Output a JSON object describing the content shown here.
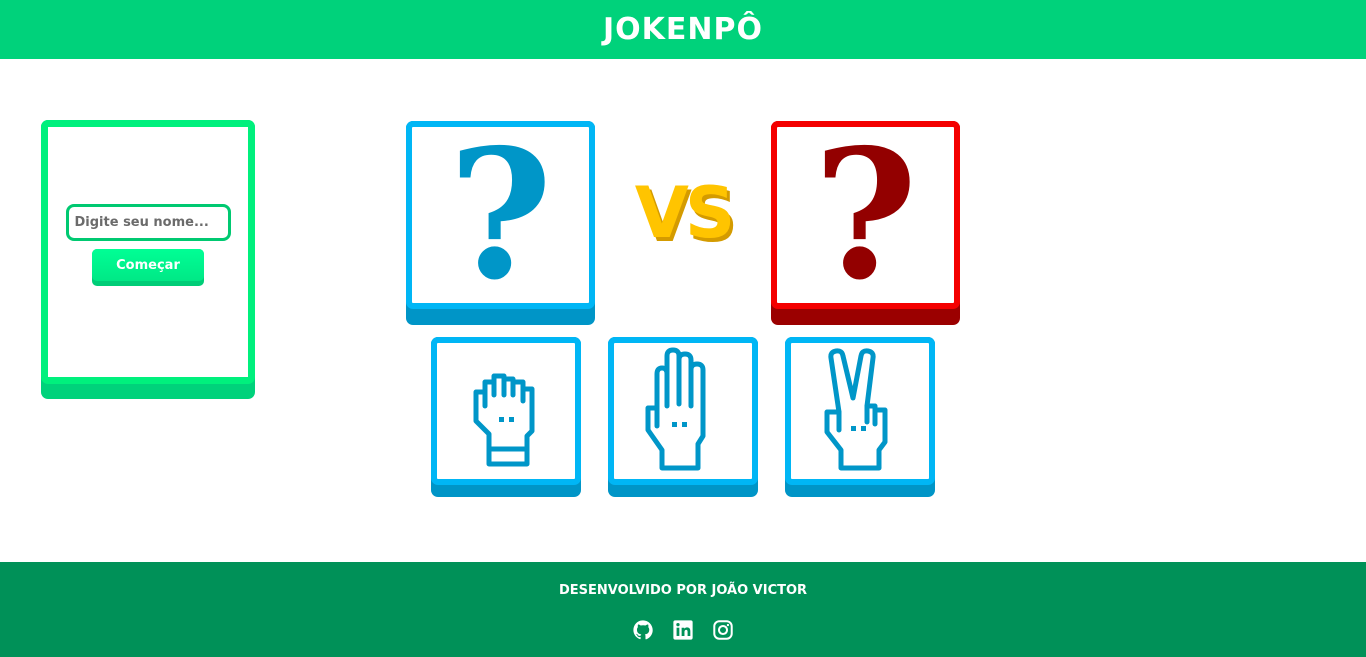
{
  "header": {
    "title": "JOKENPÔ"
  },
  "player": {
    "name_placeholder": "Digite seu nome...",
    "start_label": "Começar"
  },
  "board": {
    "player_card": "?",
    "vs_label": "VS",
    "cpu_card": "?",
    "choices": [
      "rock-hand-icon",
      "paper-hand-icon",
      "scissors-hand-icon"
    ]
  },
  "colors": {
    "header": "#00d27b",
    "footer": "#009158",
    "player": "#00b6f5",
    "player_dark": "#0095c7",
    "cpu": "#f40000",
    "cpu_dark": "#9b0000",
    "vs": "#ffc400"
  },
  "footer": {
    "credit": "DESENVOLVIDO POR JOÃO VICTOR",
    "social": [
      "github-icon",
      "linkedin-icon",
      "instagram-icon"
    ]
  }
}
